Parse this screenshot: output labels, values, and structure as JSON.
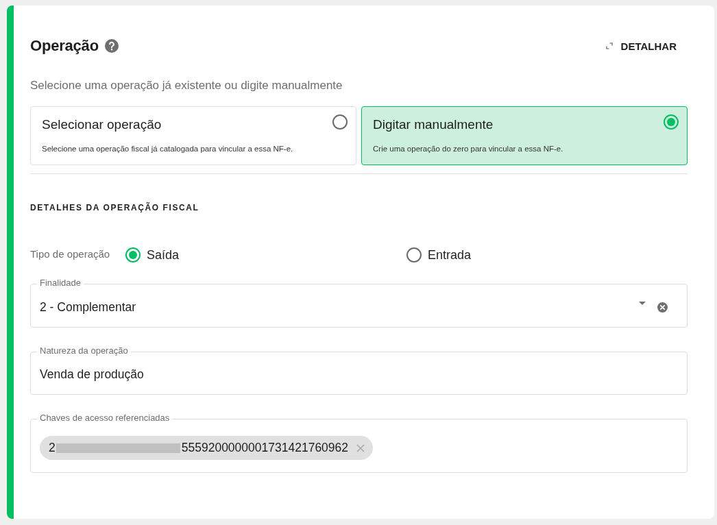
{
  "header": {
    "title": "Operação",
    "detail_button": "DETALHAR"
  },
  "instruction": "Selecione uma operação já existente ou digite manualmente",
  "options": [
    {
      "title": "Selecionar operação",
      "description": "Selecione uma operação fiscal já catalogada para vincular a essa NF-e.",
      "selected": false
    },
    {
      "title": "Digitar manualmente",
      "description": "Crie uma operação do zero para vincular a essa NF-e.",
      "selected": true
    }
  ],
  "section_title": "DETALHES DA OPERAÇÃO FISCAL",
  "operation_type": {
    "label": "Tipo de operação",
    "choices": [
      {
        "label": "Saída",
        "selected": true
      },
      {
        "label": "Entrada",
        "selected": false
      }
    ]
  },
  "fields": [
    {
      "kind": "select",
      "label": "Finalidade",
      "value": "2 - Complementar"
    },
    {
      "kind": "text",
      "label": "Natureza da operação",
      "value": "Venda de produção"
    },
    {
      "kind": "chips",
      "label": "Chaves de acesso referenciadas",
      "chips": [
        {
          "text_start": "2",
          "text_end": "5559200000001731421760962",
          "redacted": true
        }
      ]
    }
  ]
}
